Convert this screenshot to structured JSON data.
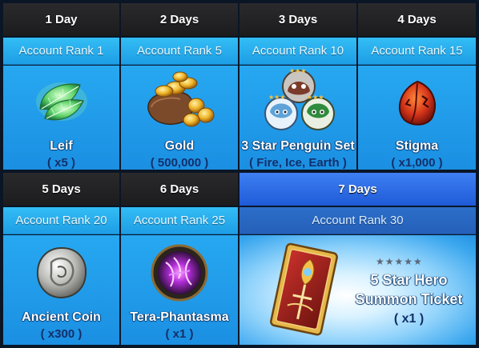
{
  "rewards": [
    {
      "day": "1 Day",
      "rank": "Account Rank 1",
      "item": "Leif",
      "qty": "( x5 )",
      "icon": "leaf-icon"
    },
    {
      "day": "2 Days",
      "rank": "Account Rank 5",
      "item": "Gold",
      "qty": "( 500,000 )",
      "icon": "gold-coins-icon"
    },
    {
      "day": "3 Days",
      "rank": "Account Rank 10",
      "item": "3 Star Penguin Set",
      "qty": "( Fire, Ice, Earth )",
      "icon": "penguin-set-icon"
    },
    {
      "day": "4 Days",
      "rank": "Account Rank 15",
      "item": "Stigma",
      "qty": "( x1,000 )",
      "icon": "stigma-icon"
    },
    {
      "day": "5 Days",
      "rank": "Account Rank 20",
      "item": "Ancient Coin",
      "qty": "( x300 )",
      "icon": "ancient-coin-icon"
    },
    {
      "day": "6 Days",
      "rank": "Account Rank 25",
      "item": "Tera-Phantasma",
      "qty": "( x1 )",
      "icon": "tera-phantasma-icon"
    },
    {
      "day": "7 Days",
      "rank": "Account Rank 30",
      "item_line1": "5 Star Hero",
      "item_line2": "Summon Ticket",
      "qty": "( x1 )",
      "stars": "★★★★★",
      "icon": "summon-ticket-icon"
    }
  ],
  "colors": {
    "header_dark": "#1c1c1e",
    "rank_bar": "#2aaef0",
    "cell_body": "#1f97e6",
    "highlight_header": "#2f6ee6",
    "qty_text": "#12306a"
  }
}
